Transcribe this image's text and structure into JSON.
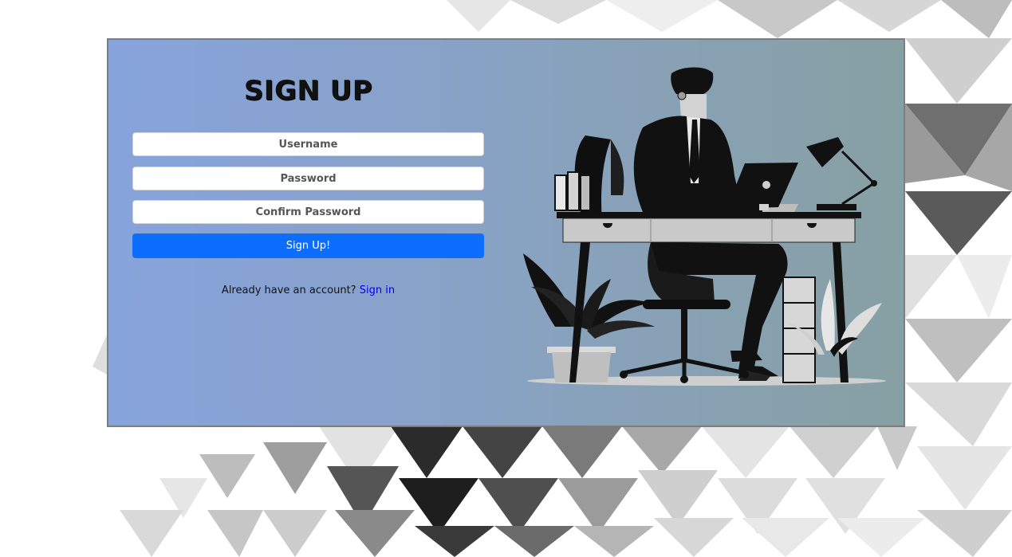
{
  "form": {
    "title": "SIGN UP",
    "username_placeholder": "Username",
    "password_placeholder": "Password",
    "confirm_password_placeholder": "Confirm Password",
    "submit_label": "Sign Up!",
    "signin_prompt": "Already have an account?",
    "signin_link": "Sign in"
  },
  "colors": {
    "primary_button": "#0d6efd",
    "link": "#0000ee",
    "card_gradient_start": "#87a3dc",
    "card_gradient_end": "#87a0a3"
  },
  "illustration": {
    "icon": "businessman-at-desk-illustration"
  }
}
